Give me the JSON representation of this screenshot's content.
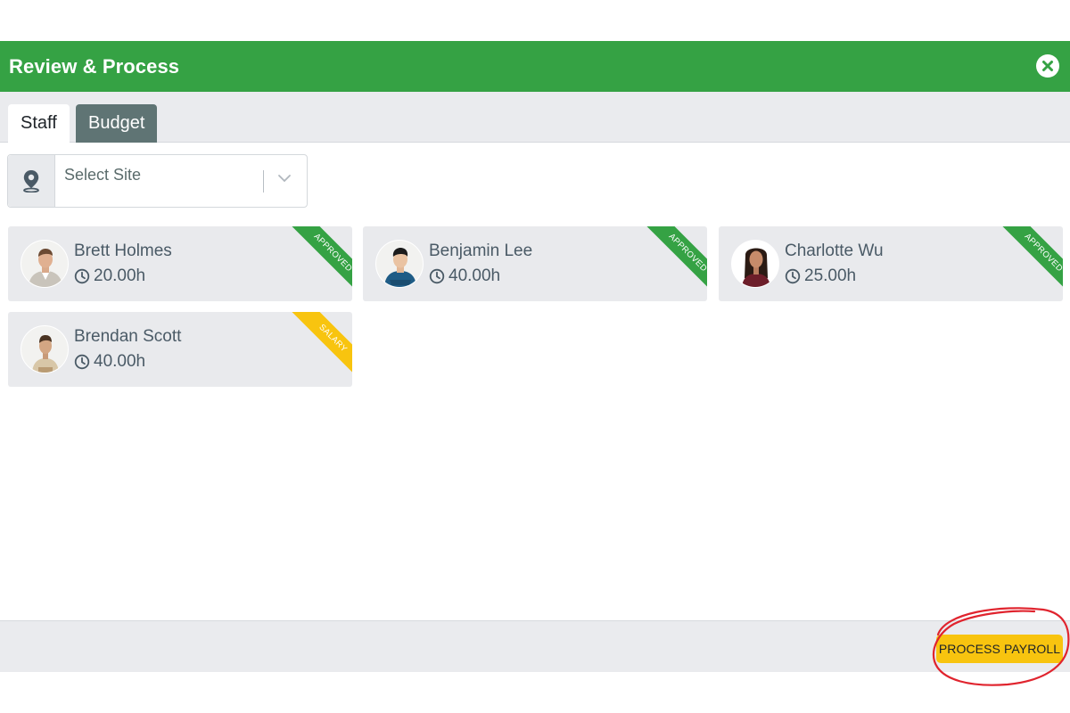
{
  "header": {
    "title": "Review & Process",
    "close_icon": "close-icon"
  },
  "tabs": [
    {
      "label": "Staff",
      "active": true
    },
    {
      "label": "Budget",
      "active": false
    }
  ],
  "site_select": {
    "icon": "map-pin-icon",
    "placeholder": "Select Site",
    "chevron_icon": "chevron-down-icon"
  },
  "staff": [
    {
      "name": "Brett Holmes",
      "hours": "20.00h",
      "status": "APPROVED",
      "status_color": "#35a244"
    },
    {
      "name": "Benjamin Lee",
      "hours": "40.00h",
      "status": "APPROVED",
      "status_color": "#35a244"
    },
    {
      "name": "Charlotte Wu",
      "hours": "25.00h",
      "status": "APPROVED",
      "status_color": "#35a244"
    },
    {
      "name": "Brendan Scott",
      "hours": "40.00h",
      "status": "SALARY",
      "status_color": "#f8c40f"
    }
  ],
  "footer": {
    "process_button": "PROCESS PAYROLL",
    "highlight_color": "#e0242e"
  },
  "colors": {
    "accent": "#35a244",
    "button": "#f8c40f",
    "budget_tab": "#5f7474"
  }
}
